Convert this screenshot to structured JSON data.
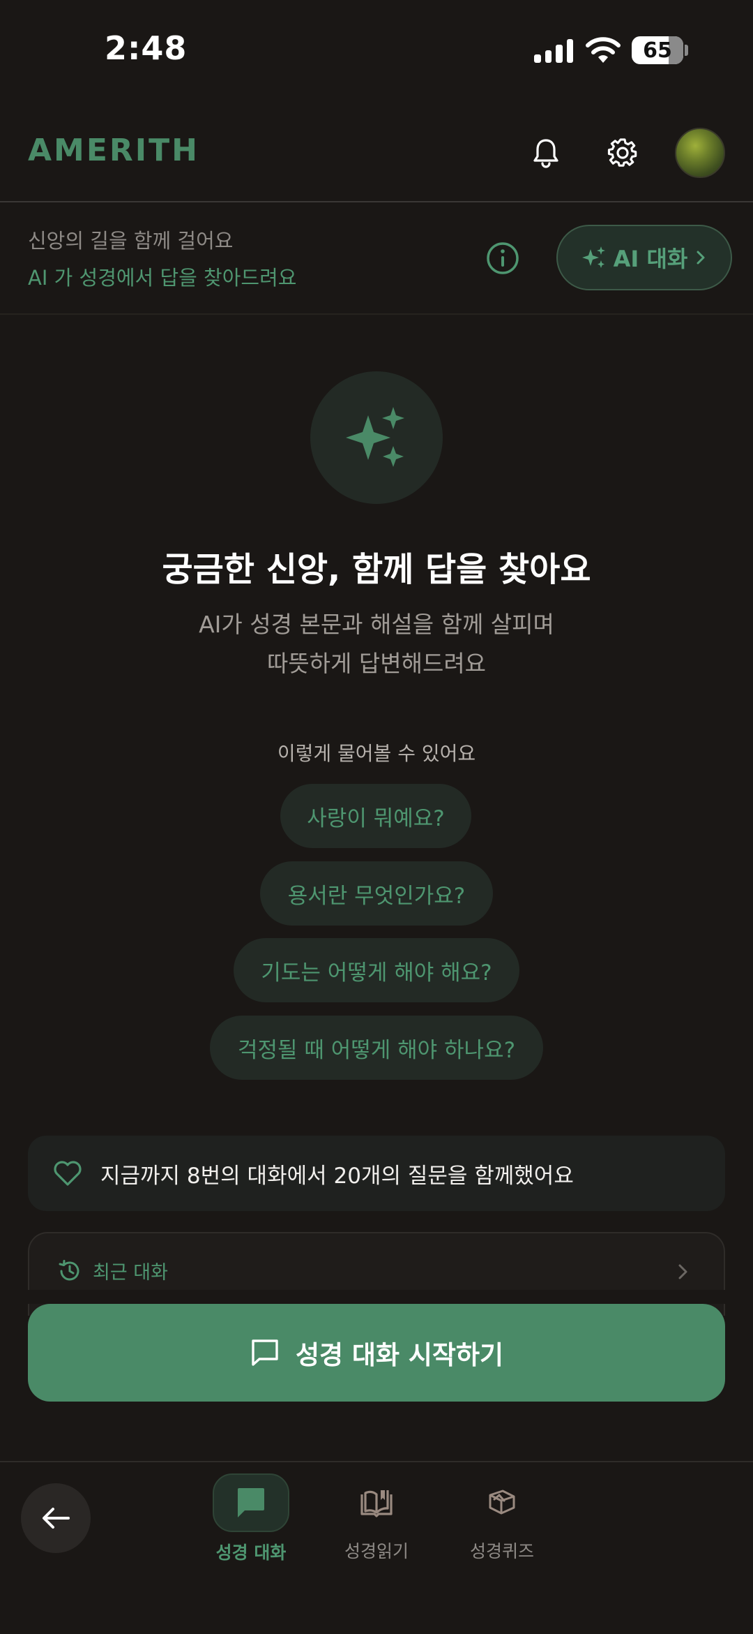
{
  "status_bar": {
    "time": "2:48",
    "battery": "65"
  },
  "header": {
    "brand": "AMERITH"
  },
  "info_bar": {
    "tagline": "신앙의 길을 함께 걸어요",
    "subtitle": "AI 가 성경에서 답을 찾아드려요",
    "chip_label": "AI 대화"
  },
  "hero": {
    "title": "궁금한 신앙, 함께 답을 찾아요",
    "line1": "AI가 성경 본문과 해설을 함께 살피며",
    "line2": "따뜻하게 답변해드려요"
  },
  "examples": {
    "label": "이렇게 물어볼 수 있어요",
    "items": [
      "사랑이 뭐예요?",
      "용서란 무엇인가요?",
      "기도는 어떻게 해야 해요?",
      "걱정될 때 어떻게 해야 하나요?"
    ]
  },
  "stats": {
    "text": "지금까지 8번의 대화에서 20개의 질문을 함께했어요"
  },
  "recent": {
    "label": "최근 대화"
  },
  "cta": {
    "label": "성경 대화 시작하기"
  },
  "nav": {
    "items": [
      {
        "label": "성경 대화",
        "icon": "chat-bubble-icon",
        "active": true
      },
      {
        "label": "성경읽기",
        "icon": "open-book-icon",
        "active": false
      },
      {
        "label": "성경퀴즈",
        "icon": "quiz-icon",
        "active": false
      }
    ]
  },
  "colors": {
    "background": "#1a1715",
    "accent": "#4a8a67",
    "accent_text": "#4e9670",
    "pill_bg": "#232a25"
  }
}
